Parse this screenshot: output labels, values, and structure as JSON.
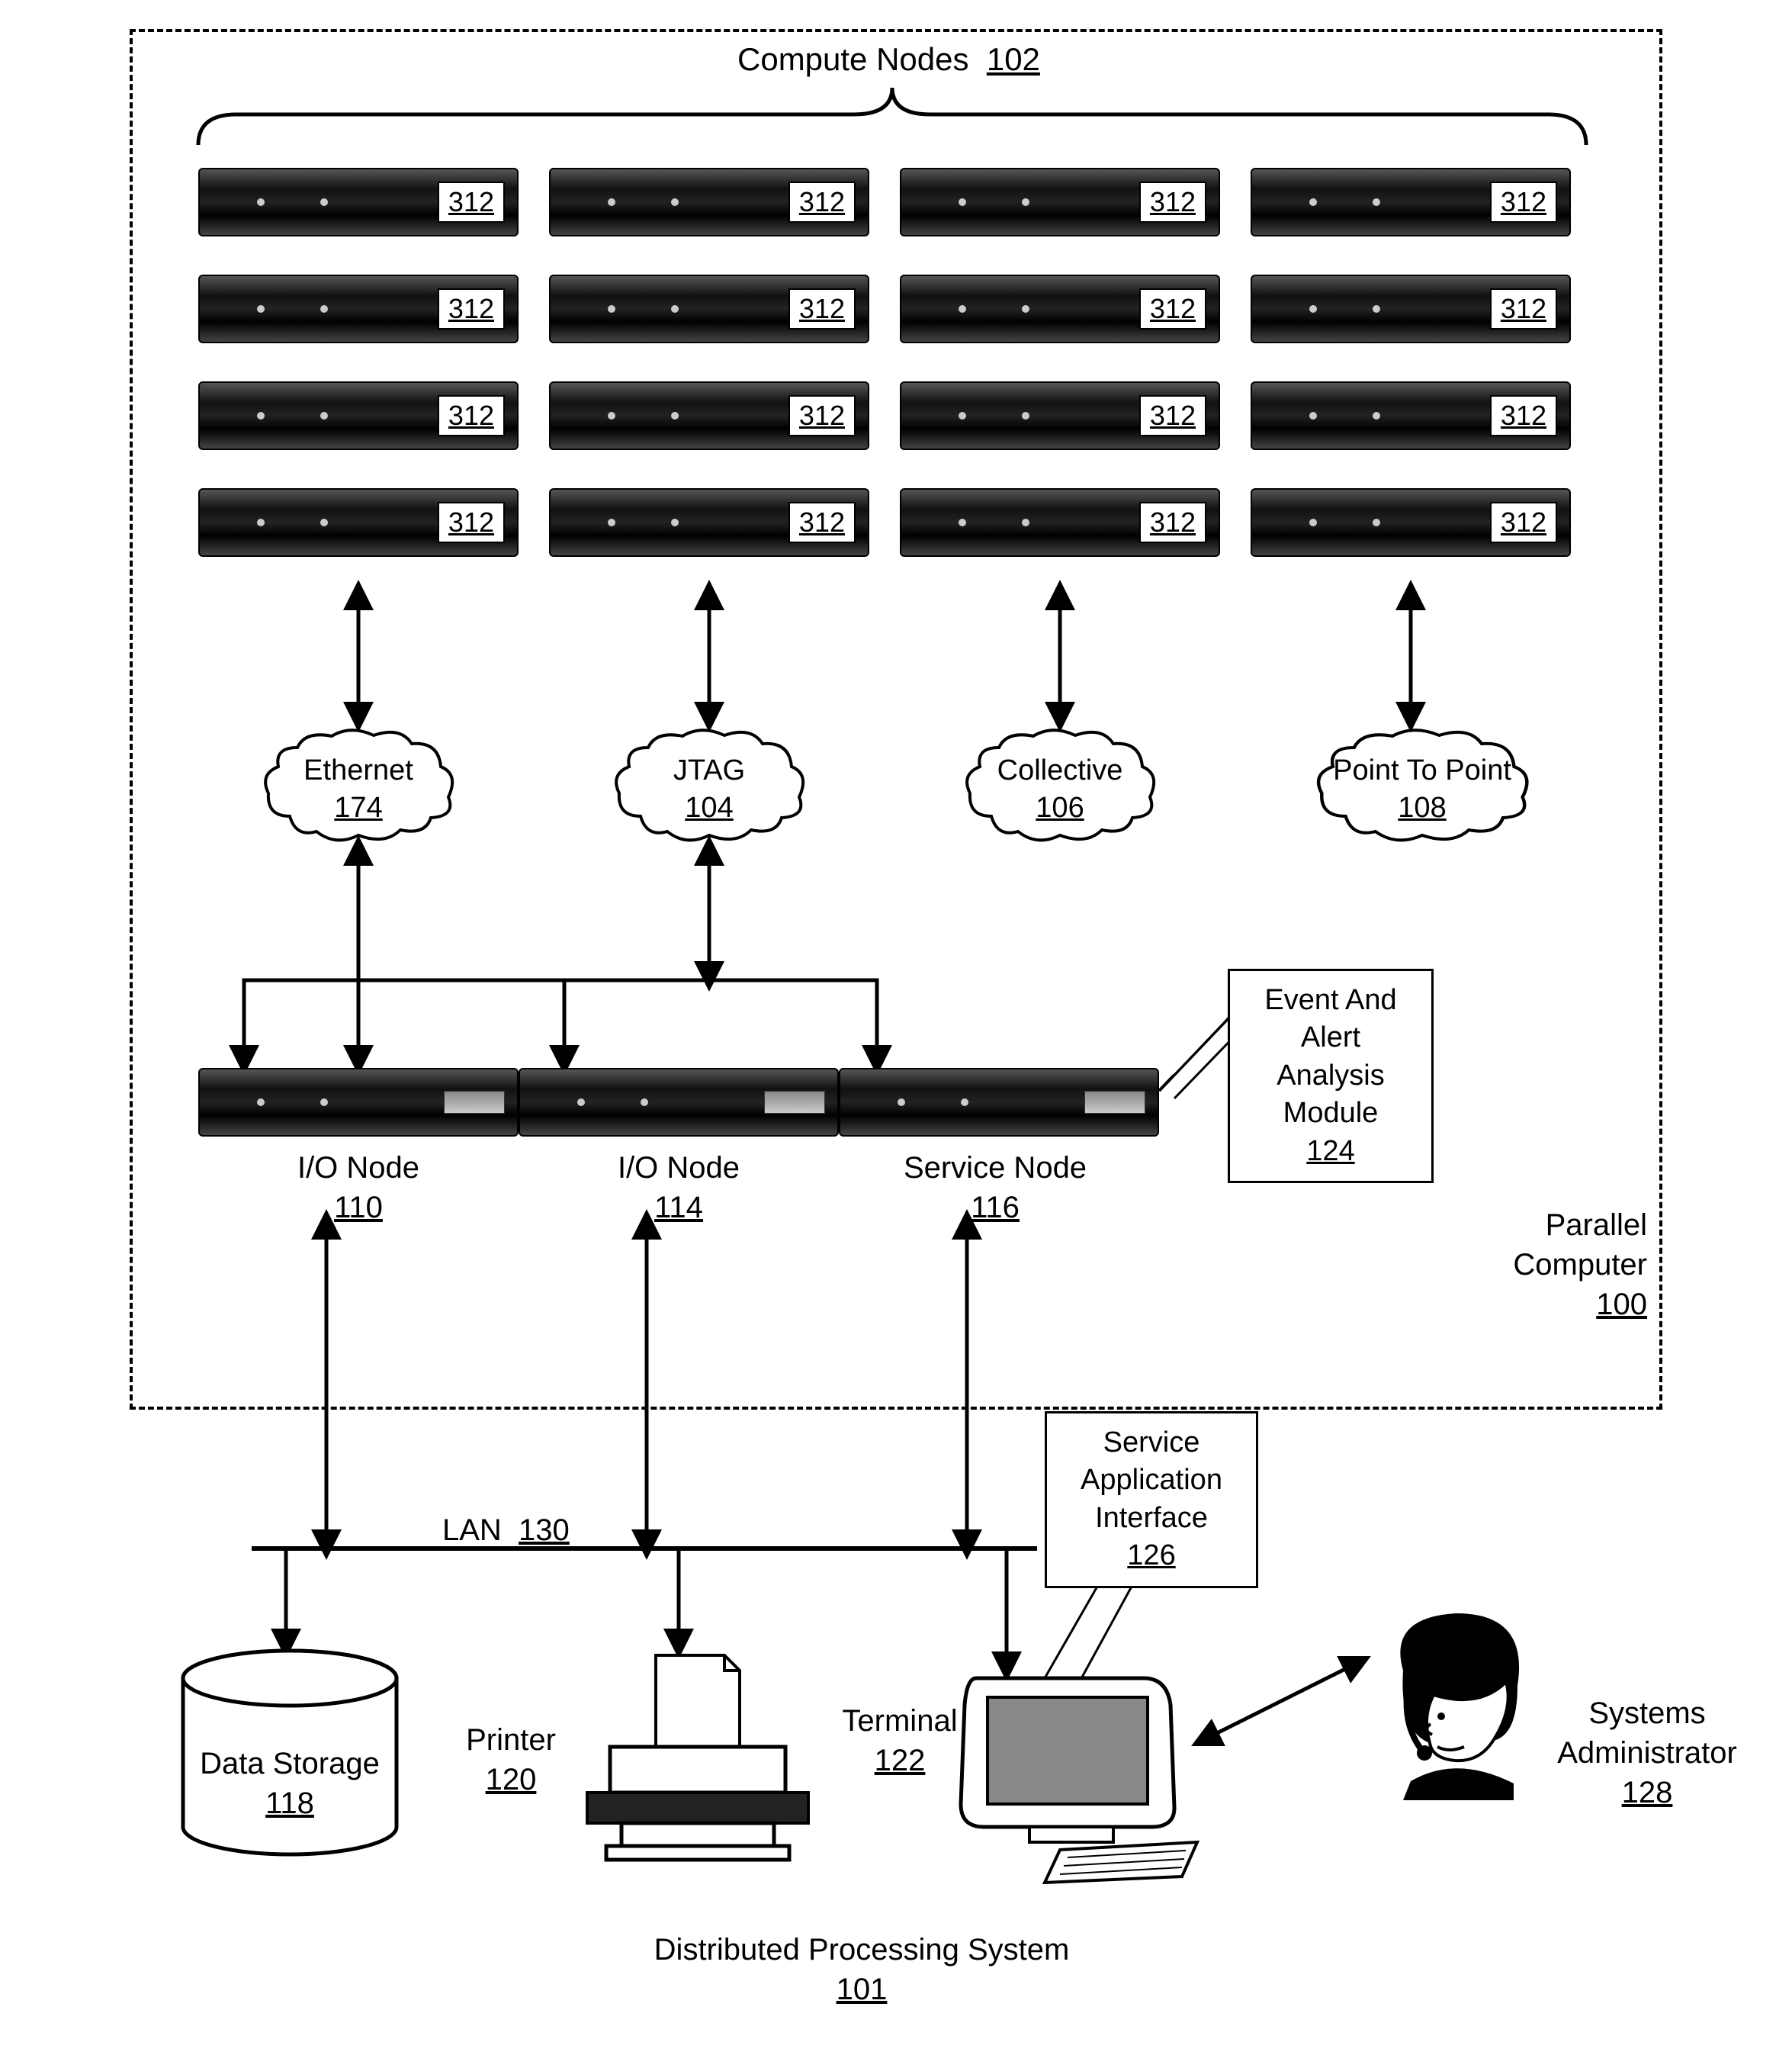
{
  "title": {
    "label": "Compute Nodes",
    "ref": "102"
  },
  "compute_node_ref": "312",
  "clouds": [
    {
      "label": "Ethernet",
      "ref": "174"
    },
    {
      "label": "JTAG",
      "ref": "104"
    },
    {
      "label": "Collective",
      "ref": "106"
    },
    {
      "label": "Point To Point",
      "ref": "108"
    }
  ],
  "lower_nodes": [
    {
      "label": "I/O Node",
      "ref": "110"
    },
    {
      "label": "I/O Node",
      "ref": "114"
    },
    {
      "label": "Service Node",
      "ref": "116"
    }
  ],
  "callouts": {
    "event_module": {
      "lines": [
        "Event And",
        "Alert",
        "Analysis",
        "Module"
      ],
      "ref": "124"
    },
    "service_interface": {
      "lines": [
        "Service",
        "Application",
        "Interface"
      ],
      "ref": "126"
    }
  },
  "side_label": {
    "label": "Parallel Computer",
    "ref": "100"
  },
  "lan": {
    "label": "LAN",
    "ref": "130"
  },
  "storage": {
    "label": "Data Storage",
    "ref": "118"
  },
  "printer": {
    "label": "Printer",
    "ref": "120"
  },
  "terminal": {
    "label": "Terminal",
    "ref": "122"
  },
  "admin": {
    "label": "Systems Administrator",
    "ref": "128"
  },
  "footer": {
    "label": "Distributed Processing System",
    "ref": "101"
  }
}
